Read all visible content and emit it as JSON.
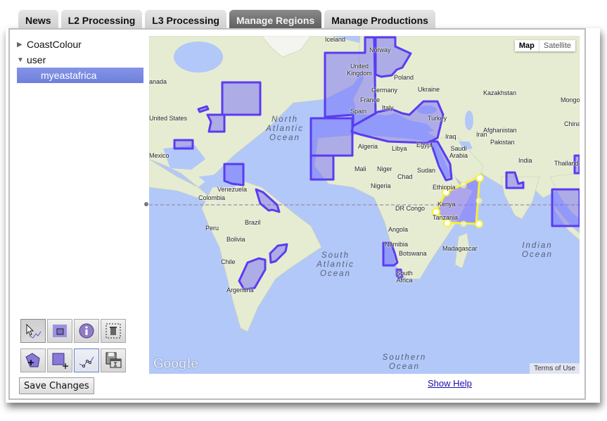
{
  "tabs": [
    {
      "label": "News",
      "active": false
    },
    {
      "label": "L2 Processing",
      "active": false
    },
    {
      "label": "L3 Processing",
      "active": false
    },
    {
      "label": "Manage Regions",
      "active": true
    },
    {
      "label": "Manage Productions",
      "active": false
    }
  ],
  "tree": {
    "groups": [
      {
        "label": "CoastColour",
        "expanded": false
      },
      {
        "label": "user",
        "expanded": true
      }
    ],
    "selected_item": "myeastafrica"
  },
  "toolbar": {
    "tools": [
      {
        "name": "select-edit-tool",
        "pressed": true
      },
      {
        "name": "zoom-to-region-tool",
        "pressed": false
      },
      {
        "name": "region-info-tool",
        "pressed": false
      },
      {
        "name": "delete-region-tool",
        "pressed": false
      },
      {
        "name": "add-polygon-tool",
        "pressed": false
      },
      {
        "name": "add-rectangle-tool",
        "pressed": false
      },
      {
        "name": "draw-polyline-tool",
        "pressed": false,
        "toggled": true
      },
      {
        "name": "export-region-tool",
        "pressed": false
      }
    ],
    "save_label": "Save Changes"
  },
  "help_link": "Show Help",
  "map": {
    "type_buttons": {
      "map": "Map",
      "satellite": "Satellite",
      "selected": "Map"
    },
    "terms": "Terms of Use",
    "logo": "Google",
    "region_color": "#5a3cf0",
    "selected_region_color": "#f5f03c",
    "labels": {
      "canada": "anada",
      "iceland": "Iceland",
      "norway": "Norway",
      "uk": "United Kingdom",
      "poland": "Poland",
      "germany": "Germany",
      "ukraine": "Ukraine",
      "france": "France",
      "spain": "Spain",
      "italy": "Italy",
      "turkey": "Turkey",
      "kazakhstan": "Kazakhstan",
      "mongolia": "Mongol",
      "china": "China",
      "afghanistan": "Afghanistan",
      "iran": "Iran",
      "iraq": "Iraq",
      "pakistan": "Pakistan",
      "india": "India",
      "thailand": "Thailand",
      "saudi": "Saudi Arabia",
      "egypt": "Egypt",
      "algeria": "Algeria",
      "libya": "Libya",
      "mali": "Mali",
      "niger": "Niger",
      "chad": "Chad",
      "sudan": "Sudan",
      "nigeria": "Nigeria",
      "ethiopia": "Ethiopia",
      "kenya": "Kenya",
      "tanzania": "Tanzania",
      "drcongo": "DR Congo",
      "angola": "Angola",
      "namibia": "Namibia",
      "botswana": "Botswana",
      "southafrica": "South Africa",
      "madagascar": "Madagascar",
      "us": "United States",
      "mexico": "Mexico",
      "venezuela": "Venezuela",
      "colombia": "Colombia",
      "brazil": "Brazil",
      "peru": "Peru",
      "bolivia": "Bolivia",
      "chile": "Chile",
      "argentina": "Argentina"
    },
    "oceans": {
      "north_atlantic": "North Atlantic Ocean",
      "south_atlantic": "South Atlantic Ocean",
      "indian": "Indian Ocean",
      "southern": "Southern Ocean"
    }
  }
}
